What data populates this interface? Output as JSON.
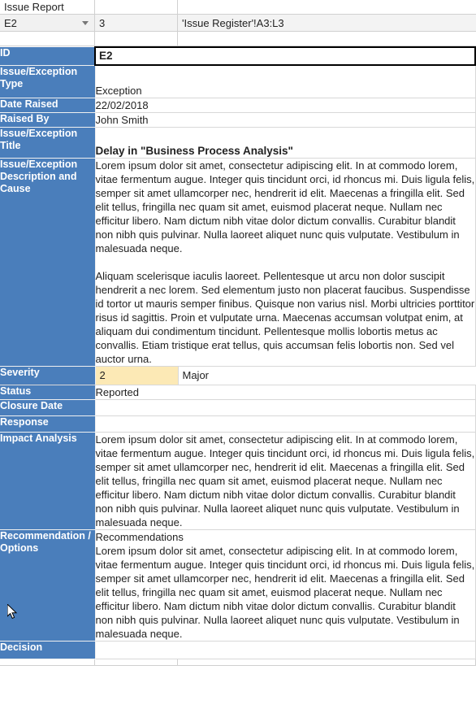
{
  "app": {
    "sheet_tab_title": "Issue Report",
    "accent_blue": "#4a7ebb",
    "highlight_yellow": "#fce9b5"
  },
  "formula_bar": {
    "name_box_value": "E2",
    "name_box_caret_icon": "chevron-down-icon",
    "cell_b_value": "3",
    "formula_value": "'Issue Register'!A3:L3"
  },
  "report": {
    "rows": [
      {
        "label": "ID",
        "value": "E2"
      },
      {
        "label": "Issue/Exception Type",
        "value": "Exception"
      },
      {
        "label": "Date Raised",
        "value": "22/02/2018"
      },
      {
        "label": "Raised By",
        "value": "John Smith"
      },
      {
        "label": "Issue/Exception Title",
        "value": "Delay in \"Business Process Analysis\""
      },
      {
        "label": "Issue/Exception Description and Cause",
        "paragraph_1": "Lorem ipsum dolor sit amet, consectetur adipiscing elit. In at commodo lorem, vitae fermentum augue. Integer quis tincidunt orci, id rhoncus mi. Duis ligula felis, semper sit amet ullamcorper nec, hendrerit id elit. Maecenas a fringilla elit. Sed elit tellus, fringilla nec quam sit amet, euismod placerat neque. Nullam nec efficitur libero. Nam dictum nibh vitae dolor dictum convallis. Curabitur blandit non nibh quis pulvinar. Nulla laoreet aliquet nunc quis vulputate. Vestibulum in malesuada neque.",
        "paragraph_2": "Aliquam scelerisque iaculis laoreet. Pellentesque ut arcu non dolor suscipit hendrerit a nec lorem. Sed elementum justo non placerat faucibus. Suspendisse id tortor ut mauris semper finibus. Quisque non varius nisl. Morbi ultricies porttitor risus id sagittis. Proin et vulputate urna. Maecenas accumsan volutpat enim, at aliquam dui condimentum tincidunt. Pellentesque mollis lobortis metus ac convallis. Etiam tristique erat tellus, quis accumsan felis lobortis non. Sed vel auctor urna."
      },
      {
        "label": "Severity",
        "value_code": "2",
        "value_text": "Major"
      },
      {
        "label": "Status",
        "value": "Reported"
      },
      {
        "label": "Closure Date",
        "value": ""
      },
      {
        "label": "Response",
        "value": ""
      },
      {
        "label": "Impact Analysis",
        "value": "Lorem ipsum dolor sit amet, consectetur adipiscing elit. In at commodo lorem, vitae fermentum augue. Integer quis tincidunt orci, id rhoncus mi. Duis ligula felis, semper sit amet ullamcorper nec, hendrerit id elit. Maecenas a fringilla elit. Sed elit tellus, fringilla nec quam sit amet, euismod placerat neque. Nullam nec efficitur libero. Nam dictum nibh vitae dolor dictum convallis. Curabitur blandit non nibh quis pulvinar. Nulla laoreet aliquet nunc quis vulputate. Vestibulum in malesuada neque."
      },
      {
        "label": "Recommendation / Options",
        "heading": "Recommendations",
        "value": "Lorem ipsum dolor sit amet, consectetur adipiscing elit. In at commodo lorem, vitae fermentum augue. Integer quis tincidunt orci, id rhoncus mi. Duis ligula felis, semper sit amet ullamcorper nec, hendrerit id elit. Maecenas a fringilla elit. Sed elit tellus, fringilla nec quam sit amet, euismod placerat neque. Nullam nec efficitur libero. Nam dictum nibh vitae dolor dictum convallis. Curabitur blandit non nibh quis pulvinar. Nulla laoreet aliquet nunc quis vulputate. Vestibulum in malesuada neque."
      },
      {
        "label": "Decision",
        "value": ""
      }
    ]
  },
  "cursor": {
    "icon": "mouse-pointer-icon"
  }
}
